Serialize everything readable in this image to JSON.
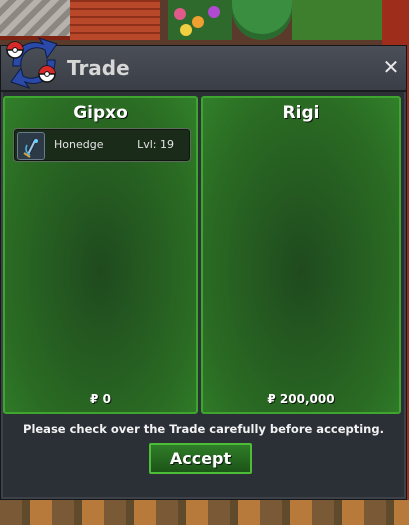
{
  "window": {
    "title": "Trade",
    "close_icon": "close-icon",
    "logo_icon": "trade-swap-icon"
  },
  "left_panel": {
    "player_name": "Gipxo",
    "items": [
      {
        "name": "Honedge",
        "level": "Lvl: 19",
        "icon": "honedge-sprite-icon"
      }
    ],
    "money": "₽ 0"
  },
  "right_panel": {
    "player_name": "Rigi",
    "items": [],
    "money": "₽ 200,000"
  },
  "footer": {
    "notice": "Please check over the Trade carefully before accepting.",
    "accept_label": "Accept"
  },
  "colors": {
    "panel_green": "#2a6b23",
    "panel_border": "#3ea52e",
    "window_bg": "#2b2f36",
    "button_green": "#2f7d28"
  }
}
